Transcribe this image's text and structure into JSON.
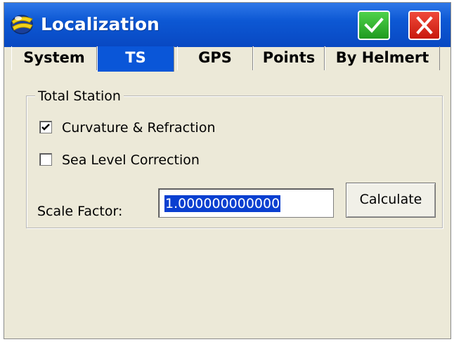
{
  "window": {
    "title": "Localization",
    "ok_icon": "checkmark-icon",
    "close_icon": "close-icon",
    "colors": {
      "titlebar": "#0d58d4",
      "ok": "#2ab12a",
      "close": "#d8261a",
      "active_tab": "#0a56d8"
    }
  },
  "tabs": [
    {
      "label": "System",
      "active": false
    },
    {
      "label": "TS",
      "active": true
    },
    {
      "label": "GPS",
      "active": false
    },
    {
      "label": "Points",
      "active": false
    },
    {
      "label": "By Helmert",
      "active": false
    }
  ],
  "group": {
    "legend": "Total Station",
    "curvature": {
      "label": "Curvature & Refraction",
      "checked": true
    },
    "sea_level": {
      "label": "Sea Level Correction",
      "checked": false
    },
    "scale_factor": {
      "label": "Scale Factor:",
      "value": "1.000000000000"
    },
    "calculate_label": "Calculate"
  }
}
